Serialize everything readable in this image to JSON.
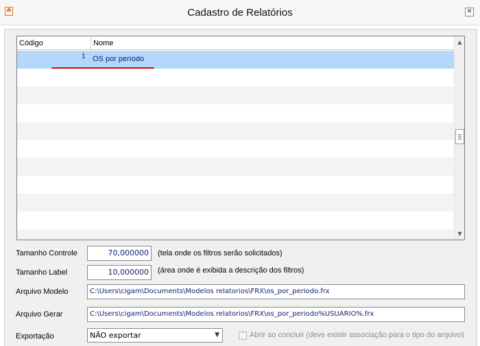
{
  "window": {
    "title": "Cadastro de Relatórios",
    "app_icon_glyph": "☘",
    "close_glyph": "✕"
  },
  "grid": {
    "columns": [
      "Código",
      "Nome"
    ],
    "rows": [
      {
        "codigo": "1",
        "nome": "OS por período",
        "selected": true
      }
    ],
    "empty_rows": 10
  },
  "form": {
    "tamanho_controle": {
      "label": "Tamanho Controle",
      "value": "70,000000",
      "hint": "(tela onde os filtros serão solicitados)"
    },
    "tamanho_label": {
      "label": "Tamanho Label",
      "value": "10,000000",
      "hint": "(área onde é exibida a descrição dos filtros)"
    },
    "arquivo_modelo": {
      "label": "Arquivo Modelo",
      "value": "C:\\Users\\cigam\\Documents\\Modelos relatorios\\FRX\\os_por_periodo.frx"
    },
    "arquivo_gerar": {
      "label": "Arquivo Gerar",
      "value": "C:\\Users\\cigam\\Documents\\Modelos relatorios\\FRX\\os_por_periodo%USUARIO%.frx"
    },
    "exportacao": {
      "label": "Exportação",
      "value": "NÃO exportar"
    },
    "abrir_ao_concluir": {
      "label": "Abrir ao concluir (deve existir associação para o tipo do arquivo)",
      "checked": false
    }
  },
  "colors": {
    "selected_row": "#b3d8fb",
    "value_text": "#102070",
    "annotation": "#e00000"
  }
}
